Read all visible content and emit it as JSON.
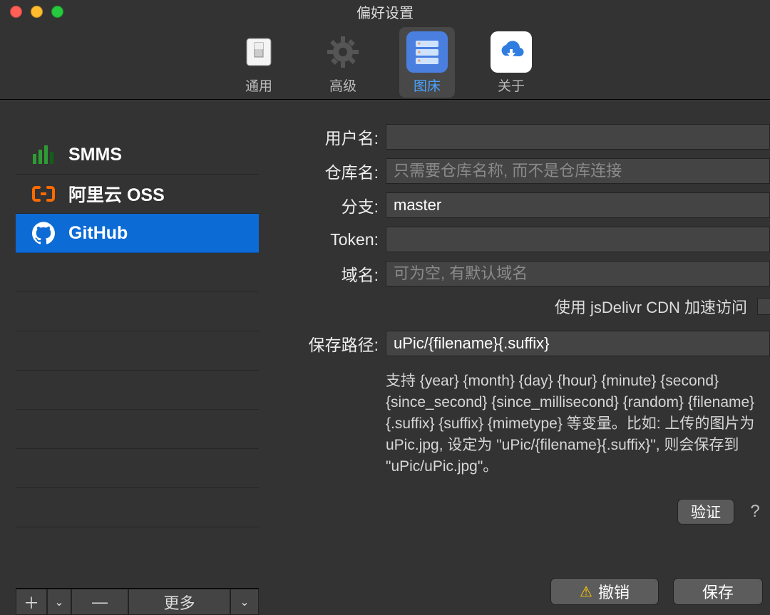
{
  "window": {
    "title": "偏好设置"
  },
  "toolbar": {
    "items": [
      {
        "label": "通用",
        "icon": "switch-icon"
      },
      {
        "label": "高级",
        "icon": "gear-icon"
      },
      {
        "label": "图床",
        "icon": "server-icon",
        "selected": true
      },
      {
        "label": "关于",
        "icon": "cloud-upload-icon"
      }
    ]
  },
  "sidebar": {
    "providers": [
      {
        "label": "SMMS",
        "icon": "bars-icon"
      },
      {
        "label": "阿里云 OSS",
        "icon": "bracket-icon"
      },
      {
        "label": "GitHub",
        "icon": "github-icon",
        "selected": true
      }
    ],
    "actions": {
      "add_label": "＋",
      "remove_label": "—",
      "more_label": "更多"
    }
  },
  "form": {
    "username": {
      "label": "用户名:",
      "value": ""
    },
    "repo": {
      "label": "仓库名:",
      "placeholder": "只需要仓库名称, 而不是仓库连接",
      "value": ""
    },
    "branch": {
      "label": "分支:",
      "value": "master"
    },
    "token": {
      "label": "Token:",
      "value": ""
    },
    "domain": {
      "label": "域名:",
      "placeholder": "可为空, 有默认域名",
      "value": ""
    },
    "cdn_label": "使用 jsDelivr CDN 加速访问",
    "save_path": {
      "label": "保存路径:",
      "value": "uPic/{filename}{.suffix}"
    },
    "hint": "支持 {year} {month} {day} {hour} {minute} {second} {since_second} {since_millisecond} {random} {filename} {.suffix} {suffix} {mimetype} 等变量。比如: 上传的图片为 uPic.jpg, 设定为 \"uPic/{filename}{.suffix}\", 则会保存到 \"uPic/uPic.jpg\"。"
  },
  "buttons": {
    "verify": "验证",
    "help": "?",
    "revert": "撤销",
    "save": "保存"
  }
}
